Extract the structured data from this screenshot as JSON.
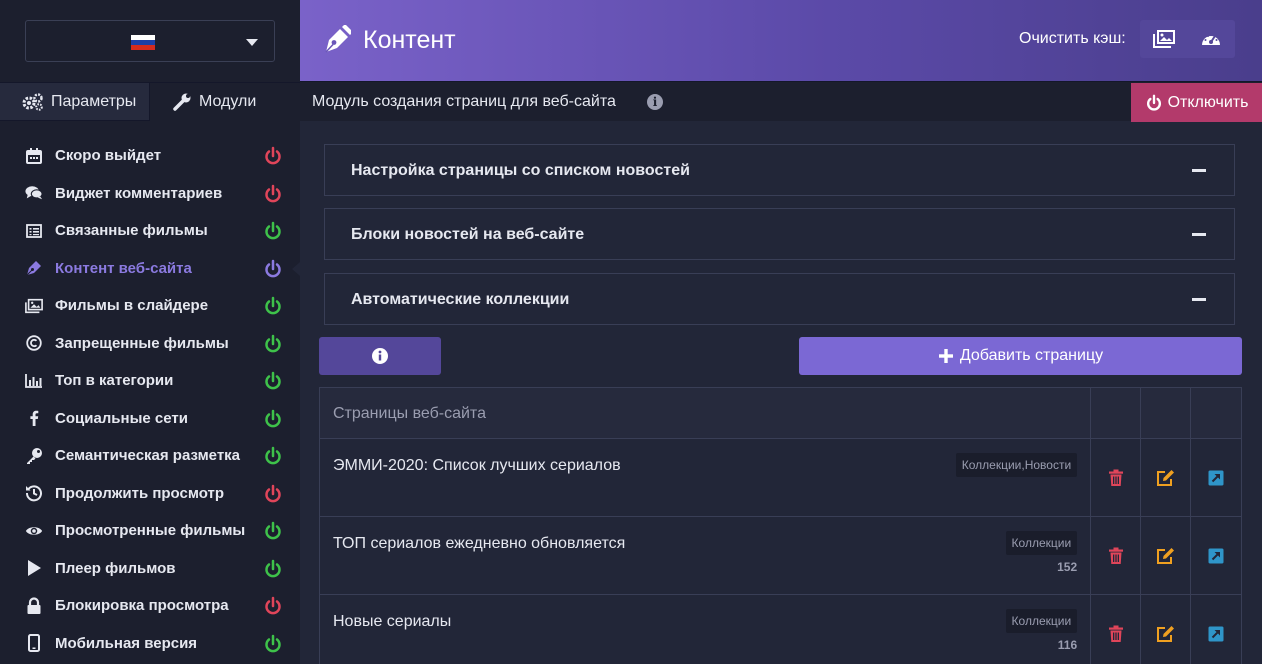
{
  "sidebar": {
    "language": {
      "flag_colors": [
        "#ffffff",
        "#1c3fa8",
        "#d52b1e"
      ]
    },
    "tabs": [
      {
        "label": "Параметры",
        "icon": "gears-icon"
      },
      {
        "label": "Модули",
        "icon": "wrench-icon"
      }
    ],
    "items": [
      {
        "label": "Скоро выйдет",
        "icon": "calendar-icon",
        "status": "off"
      },
      {
        "label": "Виджет комментариев",
        "icon": "comments-icon",
        "status": "off"
      },
      {
        "label": "Связанные фильмы",
        "icon": "list-icon",
        "status": "on"
      },
      {
        "label": "Контент веб-сайта",
        "icon": "pen-icon",
        "status": "active"
      },
      {
        "label": "Фильмы в слайдере",
        "icon": "images-icon",
        "status": "on"
      },
      {
        "label": "Запрещенные фильмы",
        "icon": "copyright-icon",
        "status": "on"
      },
      {
        "label": "Топ в категории",
        "icon": "bar-chart-icon",
        "status": "on"
      },
      {
        "label": "Социальные сети",
        "icon": "facebook-icon",
        "status": "on"
      },
      {
        "label": "Семантическая разметка",
        "icon": "key-icon",
        "status": "on"
      },
      {
        "label": "Продолжить просмотр",
        "icon": "history-icon",
        "status": "off"
      },
      {
        "label": "Просмотренные фильмы",
        "icon": "eye-icon",
        "status": "on"
      },
      {
        "label": "Плеер фильмов",
        "icon": "play-icon",
        "status": "on"
      },
      {
        "label": "Блокировка просмотра",
        "icon": "lock-icon",
        "status": "off"
      },
      {
        "label": "Мобильная версия",
        "icon": "mobile-icon",
        "status": "on"
      }
    ]
  },
  "header": {
    "title": "Контент",
    "cache_label": "Очистить кэш:"
  },
  "subheader": {
    "title": "Модуль создания страниц для веб-сайта",
    "info_glyph": "i",
    "disable_label": "Отключить"
  },
  "accordions": [
    {
      "title": "Настройка страницы со списком новостей"
    },
    {
      "title": "Блоки новостей на веб-сайте"
    },
    {
      "title": "Автоматические коллекции"
    }
  ],
  "actions": {
    "add_page_label": "Добавить страницу"
  },
  "table": {
    "header": "Страницы веб-сайта",
    "rows": [
      {
        "title": "ЭММИ-2020: Список лучших сериалов",
        "tag": "Коллекции,Новости",
        "count": ""
      },
      {
        "title": "ТОП сериалов ежедневно обновляется",
        "tag": "Коллекции",
        "count": "152"
      },
      {
        "title": "Новые сериалы",
        "tag": "Коллекции",
        "count": "116"
      }
    ]
  },
  "colors": {
    "accent": "#7b68d4",
    "status_on": "#3ec24a",
    "status_off": "#e0455a",
    "status_active": "#8b7ae0",
    "delete": "#e0455a",
    "edit": "#f0a020",
    "open": "#2f95c9"
  }
}
